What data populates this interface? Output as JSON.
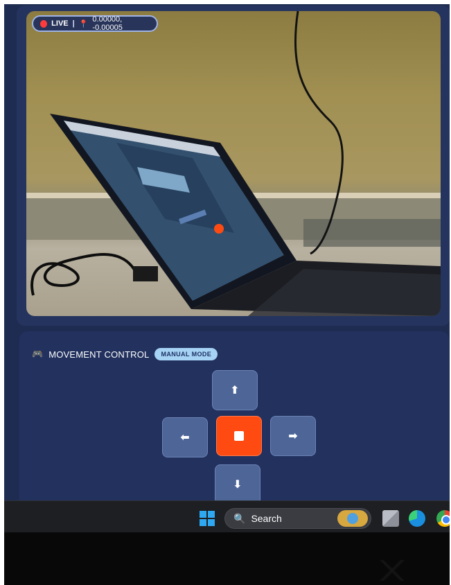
{
  "video": {
    "live_label": "LIVE",
    "separator": "|",
    "coordinates": "0.00000, -0.00005"
  },
  "movement": {
    "title": "MOVEMENT CONTROL",
    "mode_badge": "MANUAL MODE",
    "buttons": {
      "up": "⬆",
      "left": "⬅",
      "right": "➡",
      "down": "⬇"
    }
  },
  "taskbar": {
    "search_label": "Search"
  },
  "colors": {
    "stop_button": "#ff4b12",
    "live_dot": "#ff3b3b",
    "mode_badge": "#a6d2f4",
    "card_background": "#22315e"
  },
  "icons": {
    "live": "live-dot-icon",
    "location": "pin-icon",
    "controller": "gamepad-icon",
    "stop": "stop-icon",
    "search": "search-icon"
  }
}
